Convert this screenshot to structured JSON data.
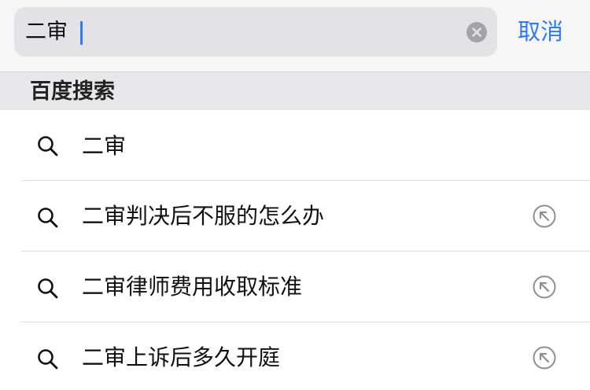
{
  "search": {
    "query": "二审",
    "cancel_label": "取消"
  },
  "section": {
    "title": "百度搜索"
  },
  "suggestions": [
    {
      "text": "二审",
      "fill_arrow": false
    },
    {
      "text": "二审判决后不服的怎么办",
      "fill_arrow": true
    },
    {
      "text": "二审律师费用收取标准",
      "fill_arrow": true
    },
    {
      "text": "二审上诉后多久开庭",
      "fill_arrow": true
    }
  ],
  "colors": {
    "accent": "#3478f6",
    "caret": "#2f7cf6"
  }
}
